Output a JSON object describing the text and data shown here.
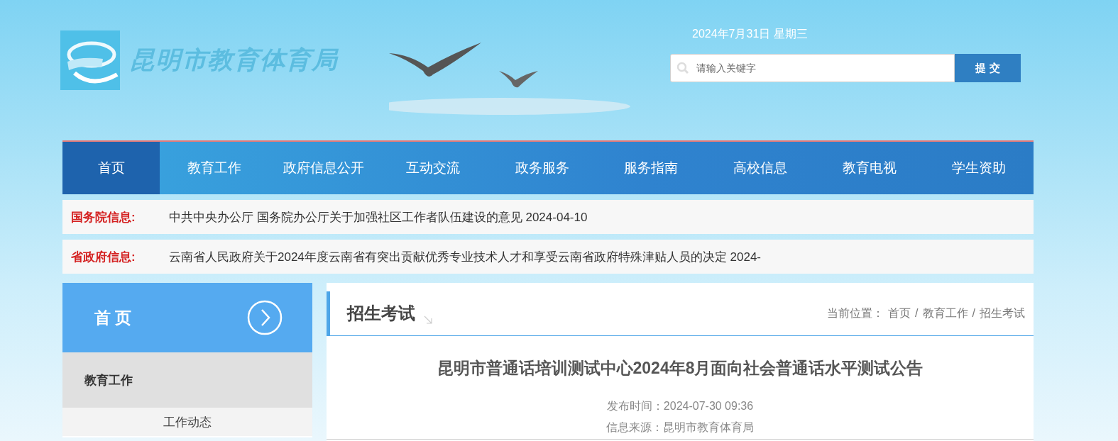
{
  "header": {
    "site_name": "昆明市教育体育局",
    "date": "2024年7月31日 星期三",
    "search": {
      "placeholder": "请输入关键字",
      "button": "提 交"
    }
  },
  "nav": [
    {
      "label": "首页",
      "selected": true
    },
    {
      "label": "教育工作",
      "selected": false
    },
    {
      "label": "政府信息公开",
      "selected": false
    },
    {
      "label": "互动交流",
      "selected": false
    },
    {
      "label": "政务服务",
      "selected": false
    },
    {
      "label": "服务指南",
      "selected": false
    },
    {
      "label": "高校信息",
      "selected": false
    },
    {
      "label": "教育电视",
      "selected": false
    },
    {
      "label": "学生资助",
      "selected": false
    }
  ],
  "notices": [
    {
      "label": "国务院信息:",
      "text": "中共中央办公厅  国务院办公厅关于加强社区工作者队伍建设的意见 2024-04-10"
    },
    {
      "label": "省政府信息:",
      "text": "云南省人民政府关于2024年度云南省有突出贡献优秀专业技术人才和享受云南省政府特殊津贴人员的决定 2024-"
    }
  ],
  "sidebar": {
    "title": "首 页",
    "section": "教育工作",
    "items": [
      {
        "label": "工作动态",
        "selected": false
      }
    ]
  },
  "article": {
    "category": "招生考试",
    "breadcrumb": {
      "label": "当前位置：",
      "separator": "/",
      "items": [
        "首页",
        "教育工作",
        "招生考试"
      ]
    },
    "title": "昆明市普通话培训测试中心2024年8月面向社会普通话水平测试公告",
    "meta": [
      "发布时间：2024-07-30 09:36",
      "信息来源：昆明市教育体育局"
    ]
  }
}
